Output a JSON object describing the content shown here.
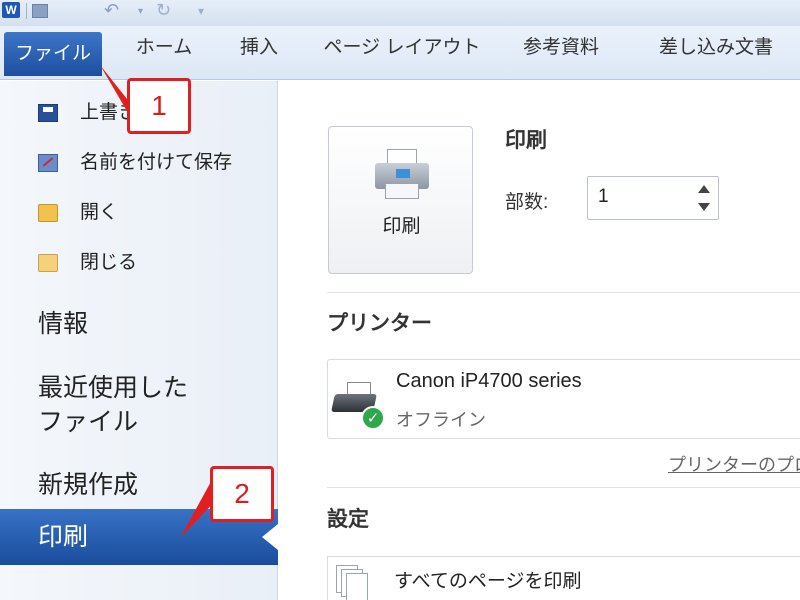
{
  "app": {
    "logo": "W"
  },
  "ribbon": {
    "file_tab": "ファイル",
    "tabs": [
      "ホーム",
      "挿入",
      "ページ レイアウト",
      "参考資料",
      "差し込み文書"
    ]
  },
  "nav": {
    "commands": [
      {
        "label": "上書き保存",
        "icon": "save-icon"
      },
      {
        "label": "名前を付けて保存",
        "icon": "save-as-icon"
      },
      {
        "label": "開く",
        "icon": "open-folder-icon"
      },
      {
        "label": "閉じる",
        "icon": "close-folder-icon"
      }
    ],
    "info": "情報",
    "recent_line1": "最近使用した",
    "recent_line2": "ファイル",
    "new": "新規作成",
    "print": "印刷"
  },
  "print_pane": {
    "print_button_label": "印刷",
    "heading": "印刷",
    "copies_label": "部数:",
    "copies_value": "1",
    "printer_section": "プリンター",
    "printer_name": "Canon iP4700 series",
    "printer_status": "オフライン",
    "printer_properties_link": "プリンターのプロパティ",
    "settings_section": "設定",
    "pages_setting": "すべてのページを印刷"
  },
  "callouts": {
    "step1": "1",
    "step2": "2"
  },
  "colors": {
    "accent": "#1d4f9e",
    "callout": "#e02020",
    "status_ok": "#2ea84b"
  }
}
